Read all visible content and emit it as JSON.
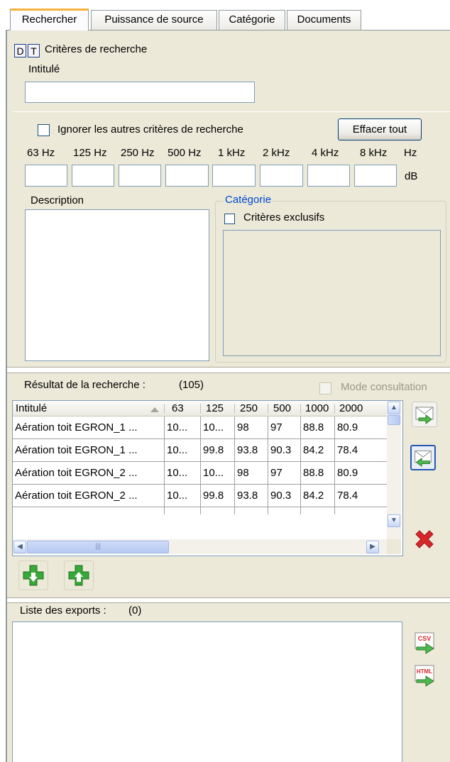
{
  "tabs": [
    {
      "label": "Rechercher"
    },
    {
      "label": "Puissance de source"
    },
    {
      "label": "Catégorie"
    },
    {
      "label": "Documents"
    }
  ],
  "search": {
    "badge_d": "D",
    "badge_t": "T",
    "criteria_title": "Critères de recherche",
    "intitule_label": "Intitulé",
    "intitule_value": "",
    "ignore_label": "Ignorer les autres critères de recherche",
    "clear_all_label": "Effacer tout",
    "freq_labels": [
      "63 Hz",
      "125 Hz",
      "250 Hz",
      "500 Hz",
      "1 kHz",
      "2 kHz",
      "4 kHz",
      "8 kHz"
    ],
    "hz_unit": "Hz",
    "db_unit": "dB",
    "description_label": "Description",
    "category_group_label": "Catégorie",
    "exclusive_label": "Critères exclusifs"
  },
  "results": {
    "title": "Résultat de la recherche :",
    "count": "(105)",
    "mode_label": "Mode consultation",
    "columns": [
      "Intitulé",
      "63",
      "125",
      "250",
      "500",
      "1000",
      "2000"
    ],
    "rows": [
      [
        "Aération toit EGRON_1 ...",
        "10...",
        "10...",
        "98",
        "97",
        "88.8",
        "80.9"
      ],
      [
        "Aération toit EGRON_1 ...",
        "10...",
        "99.8",
        "93.8",
        "90.3",
        "84.2",
        "78.4"
      ],
      [
        "Aération toit EGRON_2 ...",
        "10...",
        "10...",
        "98",
        "97",
        "88.8",
        "80.9"
      ],
      [
        "Aération toit EGRON_2 ...",
        "10...",
        "99.8",
        "93.8",
        "90.3",
        "84.2",
        "78.4"
      ]
    ]
  },
  "exports": {
    "title": "Liste des exports :",
    "count": "(0)",
    "csv_label": "CSV",
    "html_label": "HTML"
  },
  "colors": {
    "panel": "#ece9d8",
    "tab_accent": "#f6b23c",
    "link_blue": "#0046d5",
    "green_plus": "#36a936",
    "red_x": "#d9262b"
  }
}
